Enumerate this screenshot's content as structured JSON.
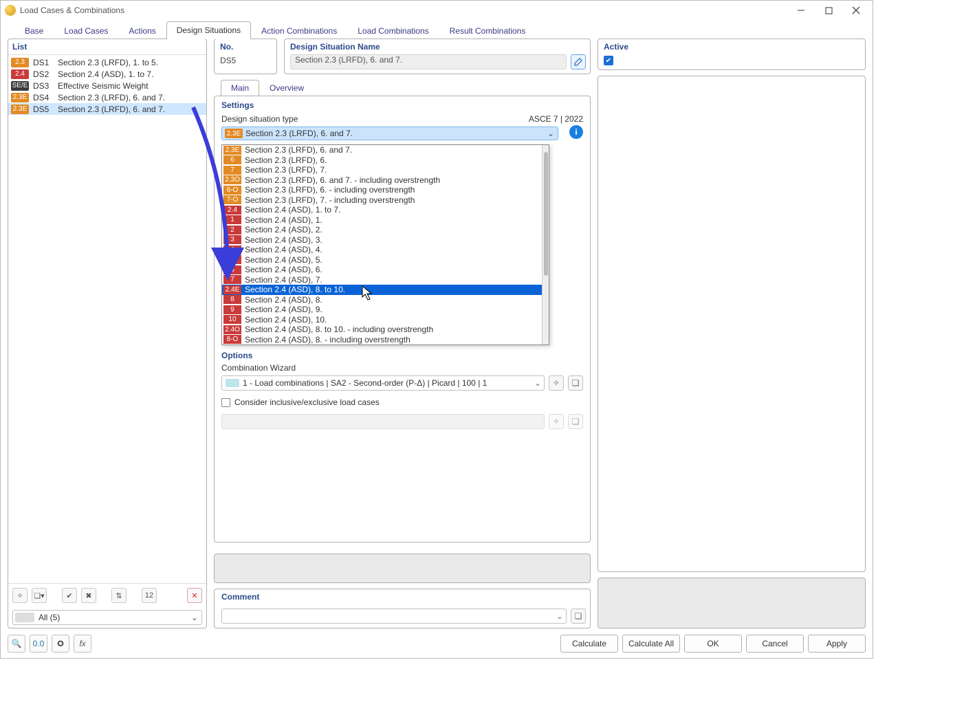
{
  "window": {
    "title": "Load Cases & Combinations"
  },
  "toptabs": [
    "Base",
    "Load Cases",
    "Actions",
    "Design Situations",
    "Action Combinations",
    "Load Combinations",
    "Result Combinations"
  ],
  "list": {
    "header": "List",
    "rows": [
      {
        "badge": "2.3",
        "color": "#e38a24",
        "id": "DS1",
        "name": "Section 2.3 (LRFD), 1. to 5."
      },
      {
        "badge": "2.4",
        "color": "#c93a3a",
        "id": "DS2",
        "name": "Section 2.4 (ASD), 1. to 7."
      },
      {
        "badge": "SE/E",
        "color": "#3b3b3b",
        "id": "DS3",
        "name": "Effective Seismic Weight"
      },
      {
        "badge": "2.3E",
        "color": "#e38a24",
        "id": "DS4",
        "name": "Section 2.3 (LRFD), 6. and 7."
      },
      {
        "badge": "2.3E",
        "color": "#e38a24",
        "id": "DS5",
        "name": "Section 2.3 (LRFD), 6. and 7."
      }
    ],
    "filter": "All (5)"
  },
  "no": {
    "header": "No.",
    "value": "DS5"
  },
  "name": {
    "header": "Design Situation Name",
    "value": "Section 2.3 (LRFD), 6. and 7."
  },
  "active": {
    "header": "Active"
  },
  "subtabs": [
    "Main",
    "Overview"
  ],
  "settings": {
    "header": "Settings",
    "type_label": "Design situation type",
    "standard": "ASCE 7 | 2022",
    "current_badge": "2.3E",
    "current_color": "#e38a24",
    "current_text": "Section 2.3 (LRFD), 6. and 7."
  },
  "dd_items": [
    {
      "b": "2.3E",
      "c": "#e38a24",
      "t": "Section 2.3 (LRFD), 6. and 7."
    },
    {
      "b": "6",
      "c": "#e38a24",
      "t": "Section 2.3 (LRFD), 6."
    },
    {
      "b": "7",
      "c": "#e38a24",
      "t": "Section 2.3 (LRFD), 7."
    },
    {
      "b": "2.3O",
      "c": "#e38a24",
      "t": "Section 2.3 (LRFD), 6. and 7. - including overstrength"
    },
    {
      "b": "6-O",
      "c": "#e38a24",
      "t": "Section 2.3 (LRFD), 6. - including overstrength"
    },
    {
      "b": "7-O",
      "c": "#e38a24",
      "t": "Section 2.3 (LRFD), 7. - including overstrength"
    },
    {
      "b": "2.4",
      "c": "#c93a3a",
      "t": "Section 2.4 (ASD), 1. to 7."
    },
    {
      "b": "1",
      "c": "#c93a3a",
      "t": "Section 2.4 (ASD), 1."
    },
    {
      "b": "2",
      "c": "#c93a3a",
      "t": "Section 2.4 (ASD), 2."
    },
    {
      "b": "3",
      "c": "#c93a3a",
      "t": "Section 2.4 (ASD), 3."
    },
    {
      "b": "4",
      "c": "#c93a3a",
      "t": "Section 2.4 (ASD), 4."
    },
    {
      "b": "5",
      "c": "#c93a3a",
      "t": "Section 2.4 (ASD), 5."
    },
    {
      "b": "6",
      "c": "#c93a3a",
      "t": "Section 2.4 (ASD), 6."
    },
    {
      "b": "7",
      "c": "#c93a3a",
      "t": "Section 2.4 (ASD), 7."
    },
    {
      "b": "2.4E",
      "c": "#c93a3a",
      "t": "Section 2.4 (ASD), 8. to 10.",
      "hl": true
    },
    {
      "b": "8",
      "c": "#c93a3a",
      "t": "Section 2.4 (ASD), 8."
    },
    {
      "b": "9",
      "c": "#c93a3a",
      "t": "Section 2.4 (ASD), 9."
    },
    {
      "b": "10",
      "c": "#c93a3a",
      "t": "Section 2.4 (ASD), 10."
    },
    {
      "b": "2.4O",
      "c": "#c93a3a",
      "t": "Section 2.4 (ASD), 8. to 10. - including overstrength"
    },
    {
      "b": "8-O",
      "c": "#c93a3a",
      "t": "Section 2.4 (ASD), 8. - including overstrength"
    }
  ],
  "options": {
    "header": "Options",
    "cw_label": "Combination Wizard",
    "cw_value": "1 - Load combinations | SA2 - Second-order (P-Δ) | Picard | 100 | 1",
    "consider": "Consider inclusive/exclusive load cases"
  },
  "comment": {
    "header": "Comment"
  },
  "footer": {
    "calculate": "Calculate",
    "calculate_all": "Calculate All",
    "ok": "OK",
    "cancel": "Cancel",
    "apply": "Apply"
  }
}
